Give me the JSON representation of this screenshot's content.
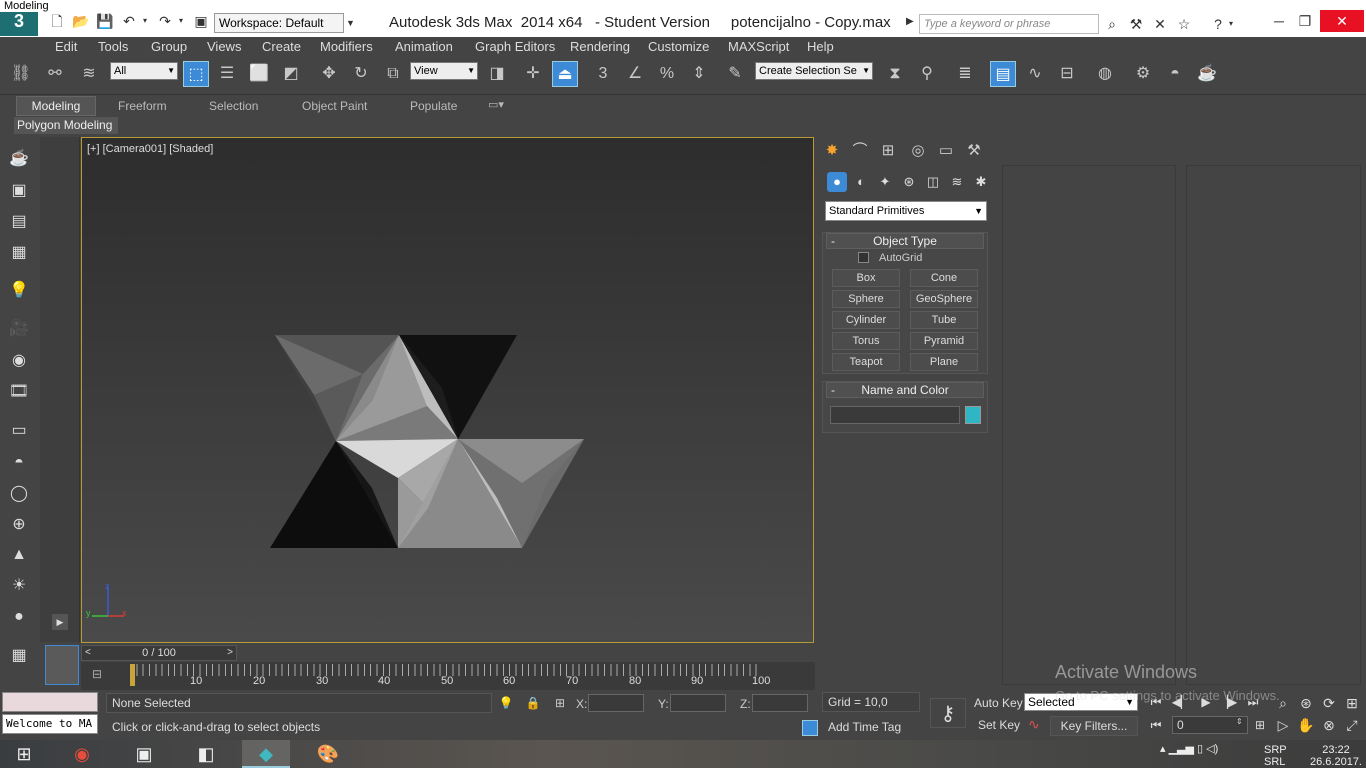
{
  "window": {
    "tiny_title": "Modeling",
    "logo_text": "3",
    "workspace": "Workspace: Default",
    "title": "Autodesk 3ds Max  2014 x64   - Student Version     potencijalno - Copy.max",
    "search_placeholder": "Type a keyword or phrase"
  },
  "menus": [
    "Edit",
    "Tools",
    "Group",
    "Views",
    "Create",
    "Modifiers",
    "Animation",
    "Graph Editors",
    "Rendering",
    "Customize",
    "MAXScript",
    "Help"
  ],
  "toolbar": {
    "selection_filter": "All",
    "ref_coord": "View",
    "named_selection": "Create Selection Se",
    "snap_label_3": "3",
    "percent_snap": "%"
  },
  "ribbon": {
    "tabs": [
      "Modeling",
      "Freeform",
      "Selection",
      "Object Paint",
      "Populate"
    ],
    "panel_label": "Polygon Modeling"
  },
  "viewport": {
    "label": "[+] [Camera001] [Shaded]",
    "axis_x": "x",
    "axis_y": "y",
    "axis_z": "z"
  },
  "command_panel": {
    "primitive_type": "Standard Primitives",
    "object_type_title": "Object Type",
    "autogrid": "AutoGrid",
    "buttons": [
      "Box",
      "Cone",
      "Sphere",
      "GeoSphere",
      "Cylinder",
      "Tube",
      "Torus",
      "Pyramid",
      "Teapot",
      "Plane"
    ],
    "name_color_title": "Name and Color",
    "color": "#2eb6c4"
  },
  "timeline": {
    "frame": "0 / 100",
    "prev": "<",
    "next": ">",
    "ticks": [
      "10",
      "20",
      "30",
      "40",
      "50",
      "60",
      "70",
      "80",
      "90",
      "100"
    ]
  },
  "status": {
    "welcome": "Welcome to MA",
    "selection": "None Selected",
    "prompt": "Click or click-and-drag to select objects",
    "x_label": "X:",
    "y_label": "Y:",
    "z_label": "Z:",
    "grid": "Grid = 10,0",
    "add_time_tag": "Add Time Tag",
    "auto_key": "Auto Key",
    "set_key": "Set Key",
    "key_mode": "Selected",
    "key_filters": "Key Filters...",
    "current_frame": "0"
  },
  "watermark": {
    "line1": "Activate Windows",
    "line2": "Go to PC settings to activate Windows."
  },
  "taskbar": {
    "lang_line1": "SRP",
    "lang_line2": "SRL",
    "time": "23:22",
    "date": "26.6.2017."
  }
}
